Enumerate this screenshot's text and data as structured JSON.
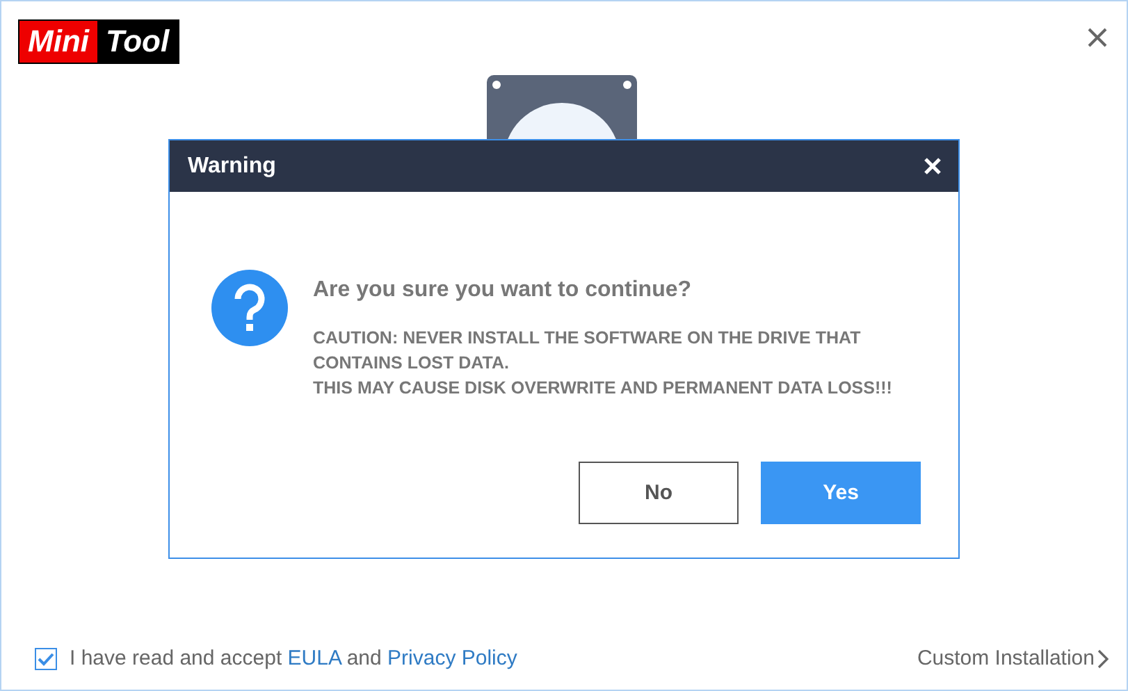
{
  "logo": {
    "left": "Mini",
    "right": "Tool"
  },
  "dialog": {
    "title": "Warning",
    "question": "Are you sure you want to continue?",
    "caution": [
      "CAUTION: NEVER INSTALL THE SOFTWARE ON THE DRIVE THAT CONTAINS LOST DATA.",
      "THIS MAY CAUSE DISK OVERWRITE AND PERMANENT DATA LOSS!!!"
    ],
    "buttons": [
      {
        "label": "No",
        "kind": "secondary"
      },
      {
        "label": "Yes",
        "kind": "primary"
      }
    ]
  },
  "footer": {
    "agree_checked": true,
    "agree_text": "I have read and accept",
    "eula_link": "EULA",
    "and_text": "and",
    "privacy_link": "Privacy Policy",
    "custom_installation": "Custom Installation"
  }
}
